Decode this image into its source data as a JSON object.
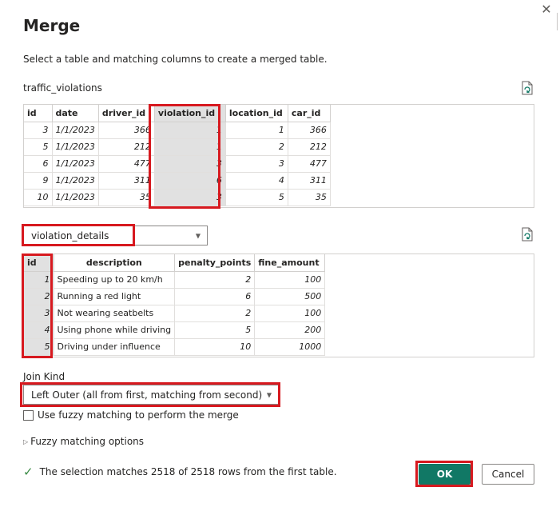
{
  "dialog": {
    "title": "Merge",
    "close_icon": "close-icon",
    "subtitle": "Select a table and matching columns to create a merged table."
  },
  "first_table": {
    "name": "traffic_violations",
    "columns": [
      "id",
      "date",
      "driver_id",
      "violation_id",
      "location_id",
      "car_id"
    ],
    "rows": [
      [
        "3",
        "1/1/2023",
        "366",
        "1",
        "1",
        "366"
      ],
      [
        "5",
        "1/1/2023",
        "212",
        "1",
        "2",
        "212"
      ],
      [
        "6",
        "1/1/2023",
        "477",
        "3",
        "3",
        "477"
      ],
      [
        "9",
        "1/1/2023",
        "311",
        "6",
        "4",
        "311"
      ],
      [
        "10",
        "1/1/2023",
        "35",
        "3",
        "5",
        "35"
      ]
    ],
    "selected_column": "violation_id"
  },
  "second_table": {
    "selected": "violation_details",
    "columns": [
      "id",
      "description",
      "penalty_points",
      "fine_amount"
    ],
    "rows": [
      [
        "1",
        "Speeding up to 20 km/h",
        "2",
        "100"
      ],
      [
        "2",
        "Running a red light",
        "6",
        "500"
      ],
      [
        "3",
        "Not wearing seatbelts",
        "2",
        "100"
      ],
      [
        "4",
        "Using phone while driving",
        "5",
        "200"
      ],
      [
        "5",
        "Driving under influence",
        "10",
        "1000"
      ]
    ],
    "selected_column": "id"
  },
  "join": {
    "label": "Join Kind",
    "selected": "Left Outer (all from first, matching from second)"
  },
  "fuzzy": {
    "checkbox_label": "Use fuzzy matching to perform the merge",
    "checked": false,
    "options_label": "Fuzzy matching options"
  },
  "status": {
    "text": "The selection matches 2518 of 2518 rows from the first table."
  },
  "buttons": {
    "ok": "OK",
    "cancel": "Cancel"
  },
  "colors": {
    "highlight_box": "#d7191f",
    "ok_button": "#117865",
    "selected_column_bg": "#e1e1e1",
    "check": "#3a8b45"
  }
}
